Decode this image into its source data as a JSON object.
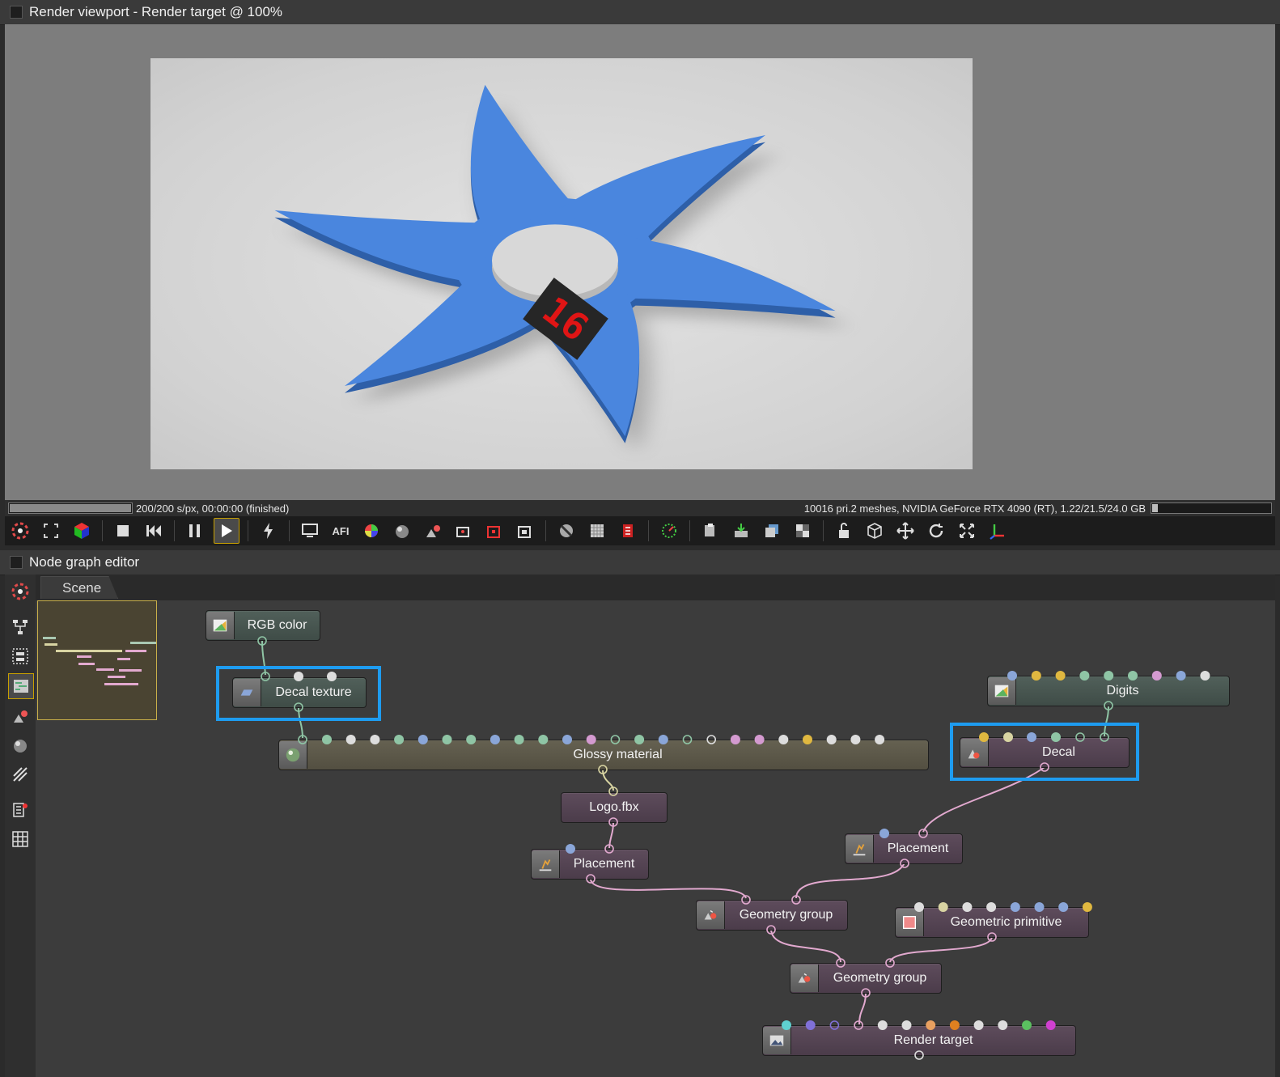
{
  "viewport": {
    "title": "Render viewport - Render target @ 100%",
    "decal_number": "16"
  },
  "status": {
    "left_text": "200/200 s/px, 00:00:00 (finished)",
    "right_text": "10016 pri.2 meshes, NVIDIA GeForce RTX 4090 (RT), 1.22/21.5/24.0 GB",
    "progress": 1.0,
    "memory_fraction": 0.05
  },
  "toolbar": {
    "afi_label": "AFI"
  },
  "node_graph": {
    "title": "Node graph editor",
    "tab": "Scene",
    "nodes": {
      "rgb_color": "RGB color",
      "decal_texture": "Decal texture",
      "glossy_material": "Glossy material",
      "logo_fbx": "Logo.fbx",
      "placement_1": "Placement",
      "digits": "Digits",
      "decal": "Decal",
      "placement_2": "Placement",
      "geometry_group_1": "Geometry group",
      "geometric_primitive": "Geometric primitive",
      "geometry_group_2": "Geometry group",
      "render_target": "Render target"
    }
  },
  "colors": {
    "highlight": "#1e9cf0",
    "logo_blue": "#3f7fd8",
    "decal_red": "#e01515"
  }
}
